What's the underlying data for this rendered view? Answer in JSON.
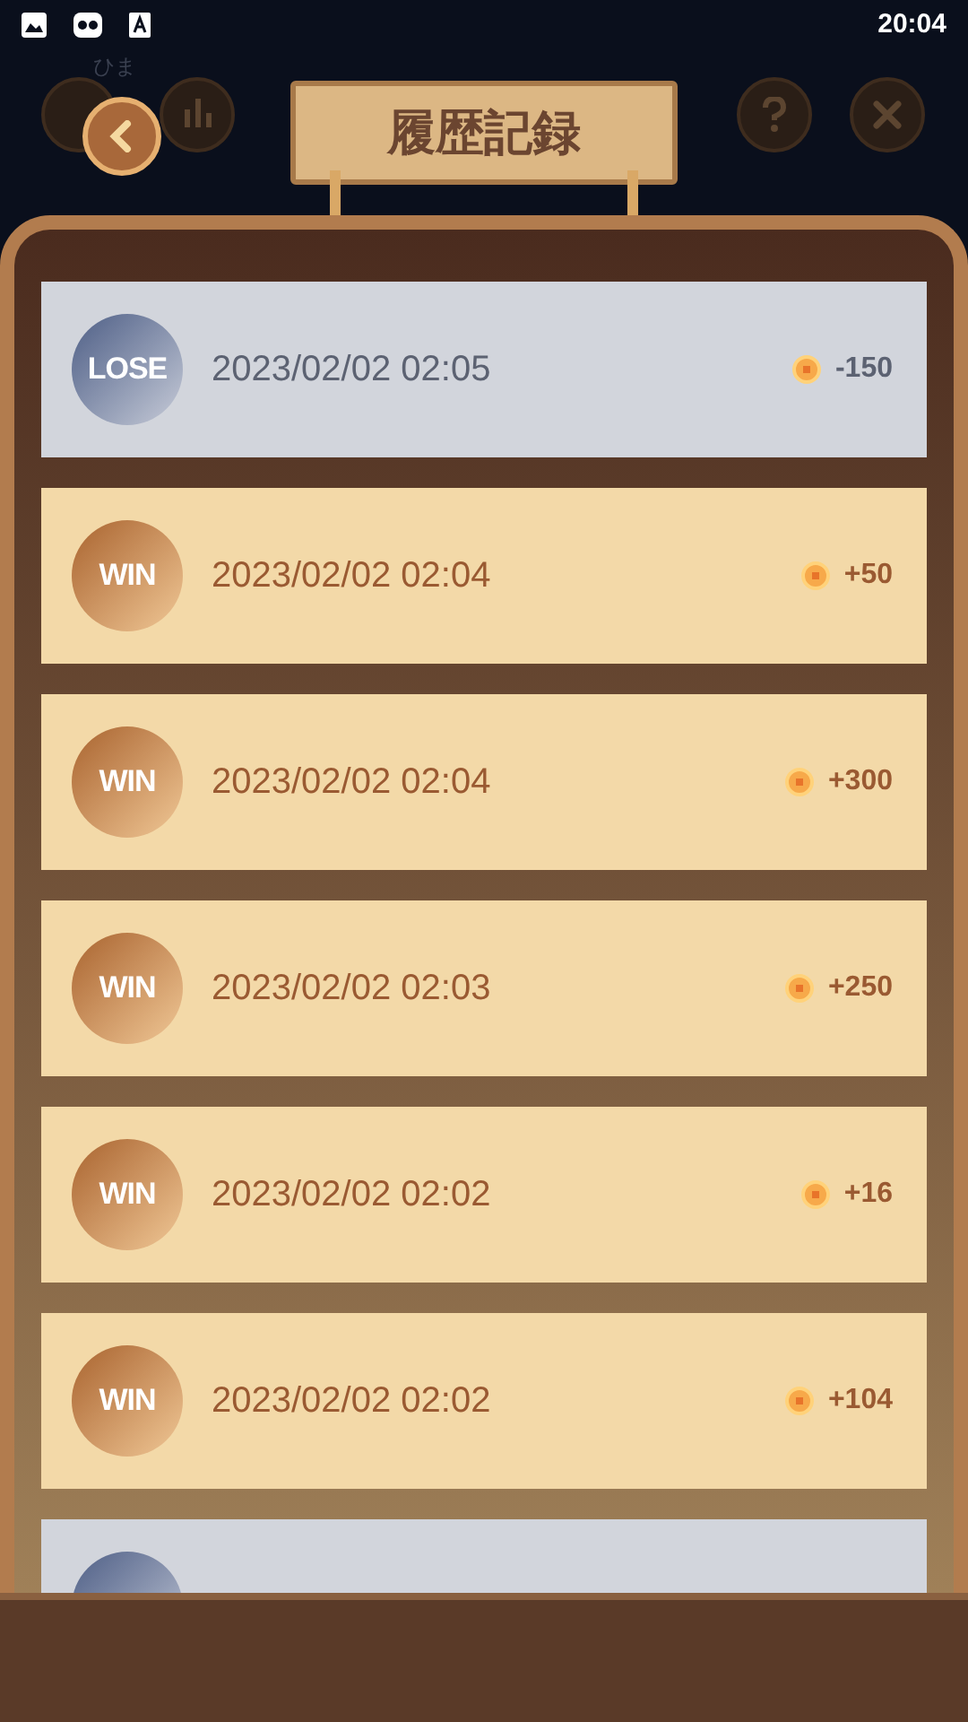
{
  "status_bar": {
    "time": "20:04"
  },
  "background": {
    "name": "ひま"
  },
  "title": "履歴記録",
  "records": [
    {
      "kind": "lose",
      "badge": "LOSE",
      "time": "2023/02/02 02:05",
      "amount": "-150"
    },
    {
      "kind": "win",
      "badge": "WIN",
      "time": "2023/02/02 02:04",
      "amount": "+50"
    },
    {
      "kind": "win",
      "badge": "WIN",
      "time": "2023/02/02 02:04",
      "amount": "+300"
    },
    {
      "kind": "win",
      "badge": "WIN",
      "time": "2023/02/02 02:03",
      "amount": "+250"
    },
    {
      "kind": "win",
      "badge": "WIN",
      "time": "2023/02/02 02:02",
      "amount": "+16"
    },
    {
      "kind": "win",
      "badge": "WIN",
      "time": "2023/02/02 02:02",
      "amount": "+104"
    },
    {
      "kind": "lose"
    }
  ]
}
